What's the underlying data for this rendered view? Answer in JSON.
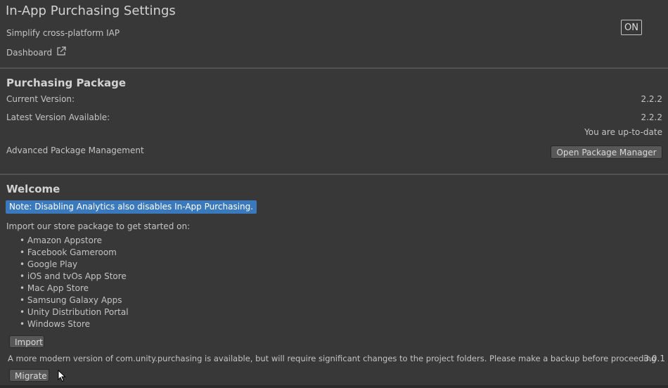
{
  "header": {
    "title": "In-App Purchasing Settings",
    "subtitle": "Simplify cross-platform IAP",
    "dashboard_label": "Dashboard",
    "toggle_label": "ON"
  },
  "package": {
    "heading": "Purchasing Package",
    "current_version_label": "Current Version:",
    "current_version": "2.2.2",
    "latest_version_label": "Latest Version Available:",
    "latest_version": "2.2.2",
    "status": "You are up-to-date",
    "advanced_label": "Advanced Package Management",
    "open_manager_button": "Open Package Manager"
  },
  "welcome": {
    "heading": "Welcome",
    "note": "Note: Disabling Analytics also disables In-App Purchasing.",
    "import_intro": "Import our store package to get started on:",
    "stores": [
      "Amazon Appstore",
      "Facebook Gameroom",
      "Google Play",
      "iOS and tvOs App Store",
      "Mac App Store",
      "Samsung Galaxy Apps",
      "Unity Distribution Portal",
      "Windows Store"
    ],
    "import_button": "Import",
    "migrate_message": "A more modern version of com.unity.purchasing is available, but will require significant changes to the project folders. Please make a backup before proceeding",
    "migrate_version": "3.0.1",
    "migrate_button": "Migrate"
  }
}
